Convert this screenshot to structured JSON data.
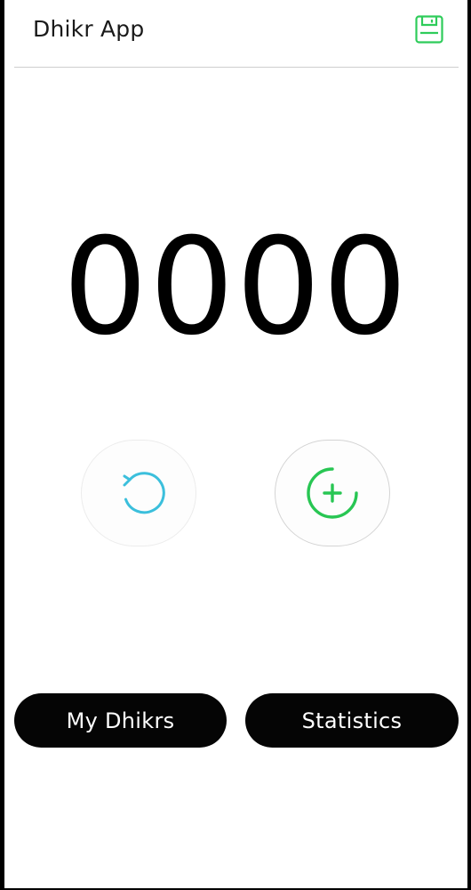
{
  "header": {
    "title": "Dhikr App",
    "save_icon": "floppy-disk-icon",
    "accent_color": "#2ecc5a"
  },
  "counter": {
    "value": "0000"
  },
  "controls": {
    "reset_icon": "reset-rotate-icon",
    "reset_color": "#3bbfdc",
    "increment_icon": "plus-circle-icon",
    "increment_color": "#28c653"
  },
  "nav": {
    "my_dhikrs_label": "My Dhikrs",
    "statistics_label": "Statistics"
  }
}
